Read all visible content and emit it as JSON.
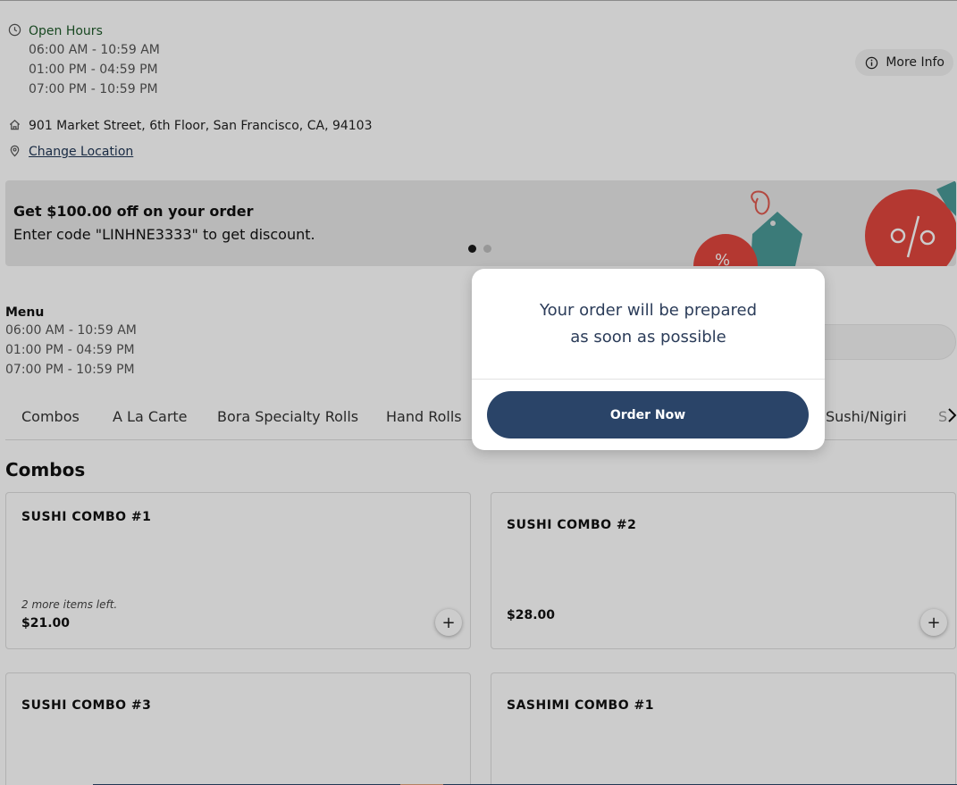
{
  "hours": {
    "title": "Open Hours",
    "lines": [
      "06:00 AM - 10:59 AM",
      "01:00 PM - 04:59 PM",
      "07:00 PM - 10:59 PM"
    ]
  },
  "location": {
    "address": "901 Market Street, 6th Floor, San Francisco, CA, 94103",
    "change_label": "Change Location"
  },
  "more_info_label": "More Info",
  "banner": {
    "title": "Get $100.00 off on your order",
    "subtitle": "Enter code \"LINHNE3333\" to get discount."
  },
  "menu": {
    "title": "Menu",
    "lines": [
      "06:00 AM - 10:59 AM",
      "01:00 PM - 04:59 PM",
      "07:00 PM - 10:59 PM"
    ]
  },
  "tabs": [
    "Combos",
    "A La Carte",
    "Bora Specialty Rolls",
    "Hand Rolls",
    "Sushi/Nigiri",
    "S"
  ],
  "section_title": "Combos",
  "items": [
    {
      "name": "SUSHI COMBO #1",
      "note": "2 more items left.",
      "price": "$21.00"
    },
    {
      "name": "SUSHI COMBO #2",
      "price": "$28.00"
    },
    {
      "name": "SUSHI COMBO #3"
    },
    {
      "name": "SASHIMI COMBO #1"
    }
  ],
  "modal": {
    "line1": "Your order will be prepared",
    "line2": "as soon as possible",
    "button": "Order Now"
  },
  "icons": {
    "clock": "clock-icon",
    "home": "home-icon",
    "pin": "location-pin-icon",
    "info": "info-icon",
    "chevron": "chevron-right-icon",
    "plus": "plus-icon"
  },
  "colors": {
    "primary": "#2a4468",
    "open_hours": "#1f5a2a",
    "modal_text": "#2b3c59"
  }
}
